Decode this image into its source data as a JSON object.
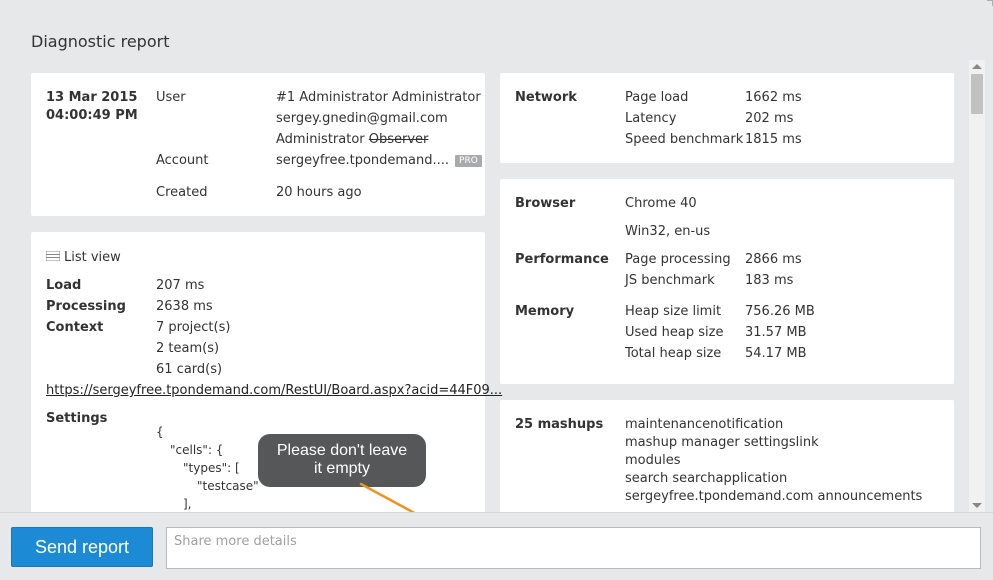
{
  "title": "Diagnostic report",
  "user_card": {
    "date": "13 Mar 2015",
    "time": "04:00:49 PM",
    "user_label": "User",
    "user_name": "#1 Administrator Administrator",
    "user_email": "sergey.gnedin@gmail.com",
    "role": "Administrator",
    "role_struck": "Observer",
    "account_label": "Account",
    "account_value": "sergeyfree.tpondemand....",
    "account_badge": "PRO",
    "created_label": "Created",
    "created_value": "20 hours ago"
  },
  "list_card": {
    "heading": "List view",
    "load_label": "Load",
    "load_value": "207 ms",
    "processing_label": "Processing",
    "processing_value": "2638 ms",
    "context_label": "Context",
    "context_values": [
      "7 project(s)",
      "2 team(s)",
      "61 card(s)"
    ],
    "url": "https://sergeyfree.tpondemand.com/RestUI/Board.aspx?acid=44F09...",
    "settings_label": "Settings",
    "settings_lines": [
      "{",
      "\"cells\": {",
      "\"types\": [",
      "\"testcase\"",
      "],"
    ]
  },
  "network_card": {
    "label": "Network",
    "rows": [
      {
        "key": "Page load",
        "value": "1662 ms"
      },
      {
        "key": "Latency",
        "value": "202 ms"
      },
      {
        "key": "Speed benchmark",
        "value": "1815 ms"
      }
    ]
  },
  "browser_card": {
    "browser_label": "Browser",
    "browser_value": "Chrome 40",
    "platform_value": "Win32, en-us",
    "performance_label": "Performance",
    "performance_rows": [
      {
        "key": "Page processing",
        "value": "2866 ms"
      },
      {
        "key": "JS benchmark",
        "value": "183 ms"
      }
    ],
    "memory_label": "Memory",
    "memory_rows": [
      {
        "key": "Heap size limit",
        "value": "756.26 MB"
      },
      {
        "key": "Used heap size",
        "value": "31.57 MB"
      },
      {
        "key": "Total heap size",
        "value": "54.17 MB"
      }
    ]
  },
  "mashups_card": {
    "label": "25 mashups",
    "items": [
      "maintenancenotification",
      "mashup manager settingslink",
      "modules",
      "search searchapplication",
      "sergeyfree.tpondemand.com announcements"
    ]
  },
  "tooltip": {
    "line1": "Please don't leave",
    "line2": "it empty"
  },
  "bottom": {
    "send_label": "Send report",
    "details_placeholder": "Share more details"
  },
  "colors": {
    "accent": "#1d8ad6",
    "tooltip_bg": "#555759",
    "arrow": "#f0921e",
    "background": "#e7e8ea"
  }
}
